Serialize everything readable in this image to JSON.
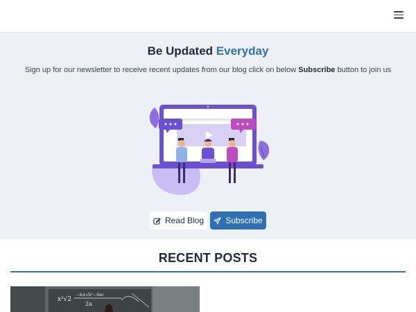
{
  "navbar": {
    "menu_icon": "hamburger-menu-icon"
  },
  "hero": {
    "title_prefix": "Be Updated",
    "title_accent": "Everyday",
    "subtitle_pre": "Sign up for our newsletter to receive recent updates from our blog click on below",
    "subtitle_bold": "Subscribe",
    "subtitle_post": "button to join us",
    "illustration": "online-learning-illustration"
  },
  "buttons": {
    "read_blog": {
      "label": "Read Blog",
      "icon": "edit-icon"
    },
    "subscribe": {
      "label": "Subscribe",
      "icon": "send-icon"
    }
  },
  "recent_posts": {
    "title": "RECENT POSTS",
    "posts": [
      {
        "image": "chalkboard-lecture-image",
        "board_text": [
          "x²√2",
          "−b±√b²−4ac",
          "2a"
        ]
      }
    ]
  },
  "colors": {
    "accent": "#2f6fb3",
    "hero_bg": "#edf1f6",
    "text": "#1f2937",
    "illustration_purple": "#6b4fd6"
  }
}
